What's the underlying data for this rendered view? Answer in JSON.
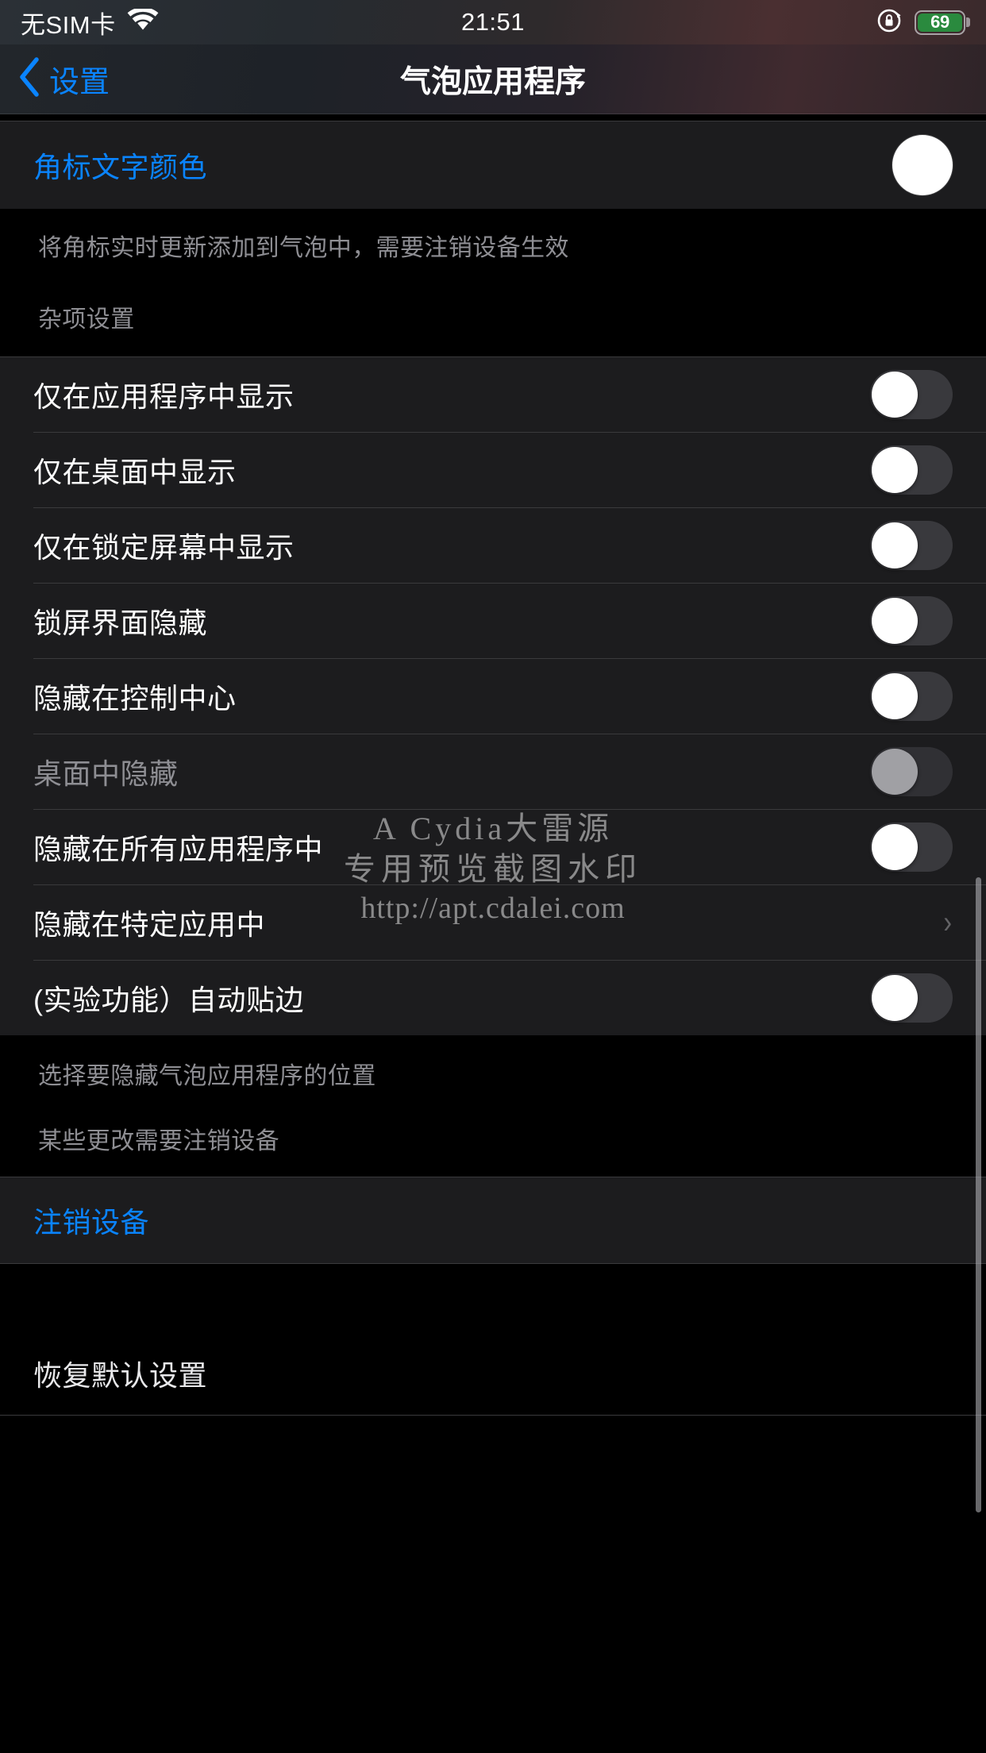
{
  "status_bar": {
    "carrier": "无SIM卡",
    "wifi_icon": "wifi-icon",
    "time": "21:51",
    "rotation_lock_icon": "rotation-lock-icon",
    "battery_percent": "69",
    "battery_color": "#2a8a3e"
  },
  "nav": {
    "back_icon": "chevron-left-icon",
    "back_label": "设置",
    "title": "气泡应用程序"
  },
  "accent_color": "#0a84ff",
  "section_color_group": {
    "rows": [
      {
        "label": "角标文字颜色",
        "type": "color",
        "swatch_color": "#ffffff",
        "style": "blue"
      }
    ],
    "footer": "将角标实时更新添加到气泡中，需要注销设备生效"
  },
  "section_misc": {
    "header": "杂项设置",
    "rows": [
      {
        "label": "仅在应用程序中显示",
        "type": "switch",
        "value": "off",
        "enabled": true
      },
      {
        "label": "仅在桌面中显示",
        "type": "switch",
        "value": "off",
        "enabled": true
      },
      {
        "label": "仅在锁定屏幕中显示",
        "type": "switch",
        "value": "off",
        "enabled": true
      },
      {
        "label": "锁屏界面隐藏",
        "type": "switch",
        "value": "off",
        "enabled": true
      },
      {
        "label": "隐藏在控制中心",
        "type": "switch",
        "value": "off",
        "enabled": true
      },
      {
        "label": "桌面中隐藏",
        "type": "switch",
        "value": "off",
        "enabled": false
      },
      {
        "label": "隐藏在所有应用程序中",
        "type": "switch",
        "value": "off",
        "enabled": true
      },
      {
        "label": "隐藏在特定应用中",
        "type": "disclosure",
        "chevron_icon": "chevron-right-icon"
      },
      {
        "label": "(实验功能）自动贴边",
        "type": "switch",
        "value": "off",
        "enabled": true
      }
    ],
    "footer_line_1": "选择要隐藏气泡应用程序的位置",
    "footer_line_2": "某些更改需要注销设备"
  },
  "section_actions": {
    "respring": {
      "label": "注销设备",
      "style": "blue"
    },
    "reset": {
      "label": "恢复默认设置",
      "style": "white"
    }
  },
  "watermark": {
    "line1": "A Cydia大雷源",
    "line2": "专用预览截图水印",
    "line3": "http://apt.cdalei.com"
  }
}
